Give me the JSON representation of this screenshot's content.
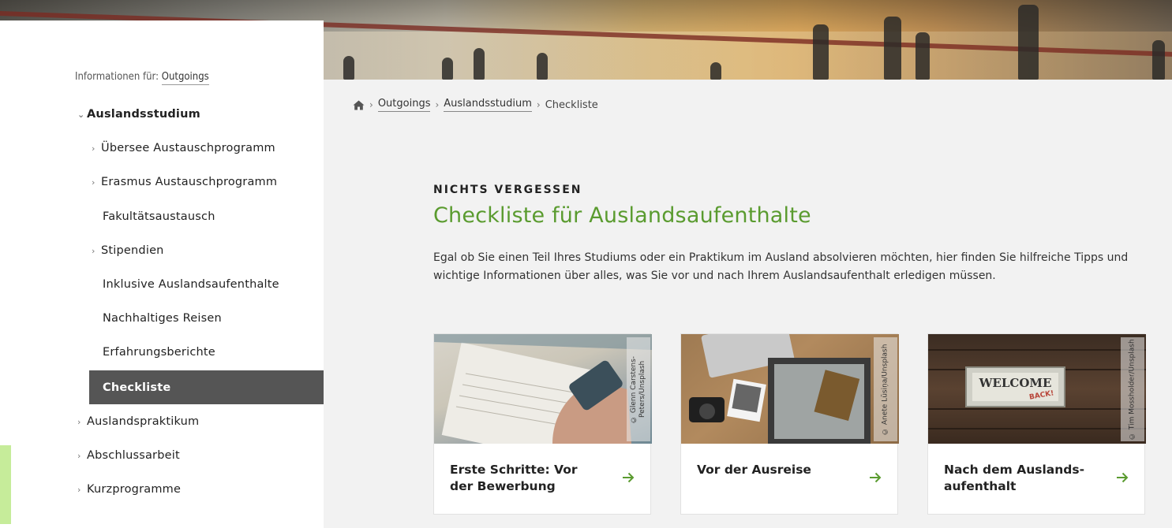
{
  "sidebar": {
    "info_prefix": "Informationen für:",
    "info_link": "Outgoings",
    "items": [
      {
        "label": "Auslandsstudium",
        "chevron": "⌄"
      },
      {
        "label": "Übersee Austauschprogramm",
        "chevron": "›"
      },
      {
        "label": "Erasmus Austauschprogramm",
        "chevron": "›"
      },
      {
        "label": "Fakultätsaustausch",
        "chevron": ""
      },
      {
        "label": "Stipendien",
        "chevron": "›"
      },
      {
        "label": "Inklusive Auslandsaufenthalte",
        "chevron": ""
      },
      {
        "label": "Nachhaltiges Reisen",
        "chevron": ""
      },
      {
        "label": "Erfahrungsberichte",
        "chevron": ""
      },
      {
        "label": "Checkliste",
        "chevron": ""
      },
      {
        "label": "Auslandspraktikum",
        "chevron": "›"
      },
      {
        "label": "Abschlussarbeit",
        "chevron": "›"
      },
      {
        "label": "Kurzprogramme",
        "chevron": "›"
      }
    ]
  },
  "breadcrumb": {
    "sep": "›",
    "items": [
      "Outgoings",
      "Auslandsstudium",
      "Checkliste"
    ]
  },
  "main": {
    "eyebrow": "NICHTS VERGESSEN",
    "heading": "Checkliste für Auslandsaufenthalte",
    "intro": "Egal ob Sie einen Teil Ihres Studiums oder ein Praktikum im Ausland absolvieren möchten, hier finden Sie hilfreiche Tipps und wichtige Informationen über alles, was Sie vor und nach Ihrem Auslandsaufenthalt erledigen müssen."
  },
  "cards": [
    {
      "title": "Erste Schritte: Vor der Bewerbung",
      "credit": "© Glenn Carstens-Peters/Unsplash"
    },
    {
      "title": "Vor der Ausreise",
      "credit": "© Anete Lūsiņa/Unsplash"
    },
    {
      "title": "Nach dem Auslands-aufenthalt",
      "credit": "© Tim Mossholder/Unsplash",
      "sign": "WELCOME",
      "sign_sub": "BACK!"
    }
  ],
  "colors": {
    "accent_green": "#5a9b2f",
    "active_nav_bg": "#555555",
    "page_bg": "#f2f2f2"
  }
}
